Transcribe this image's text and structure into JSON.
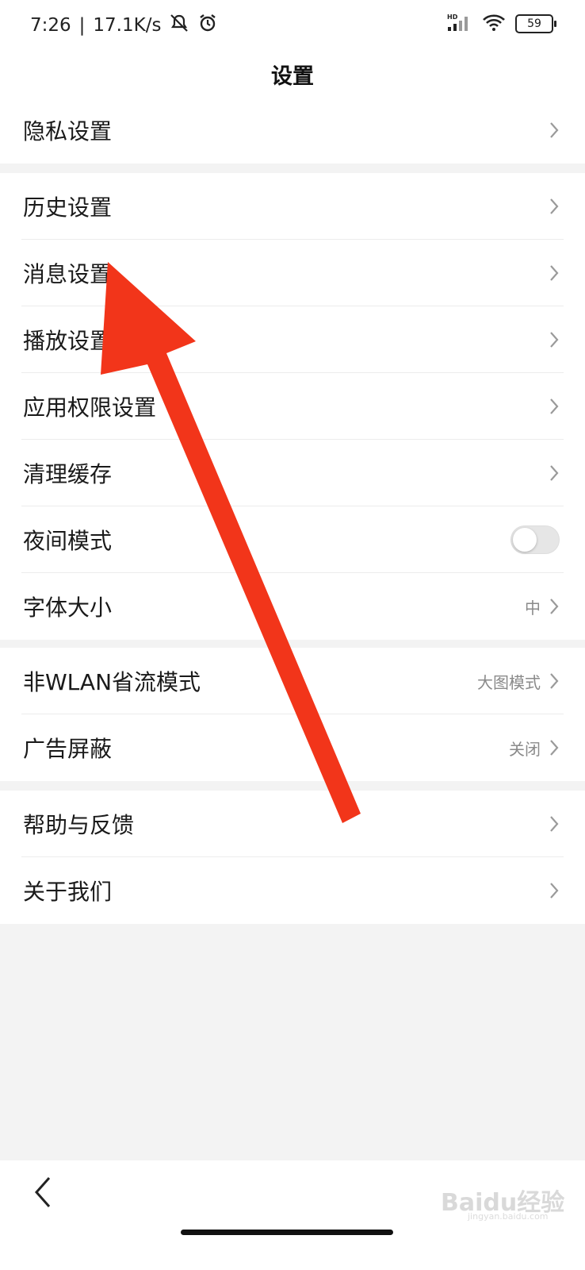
{
  "status_bar": {
    "time": "7:26",
    "network_speed": "17.1K/s",
    "signal_label": "HD",
    "battery": "59",
    "icons": [
      "mute-bell-icon",
      "alarm-icon",
      "signal-icon",
      "wifi-icon",
      "battery-icon"
    ]
  },
  "header": {
    "title": "设置"
  },
  "groups": {
    "privacy": {
      "items": [
        {
          "label": "隐私设置"
        }
      ]
    },
    "main": {
      "items": [
        {
          "label": "历史设置"
        },
        {
          "label": "消息设置"
        },
        {
          "label": "播放设置"
        },
        {
          "label": "应用权限设置"
        },
        {
          "label": "清理缓存"
        },
        {
          "label": "夜间模式",
          "toggle": false
        },
        {
          "label": "字体大小",
          "value": "中"
        }
      ]
    },
    "data": {
      "items": [
        {
          "label": "非WLAN省流模式",
          "value": "大图模式"
        },
        {
          "label": "广告屏蔽",
          "value": "关闭"
        }
      ]
    },
    "about": {
      "items": [
        {
          "label": "帮助与反馈"
        },
        {
          "label": "关于我们"
        }
      ]
    }
  },
  "watermark": {
    "text": "Baidu经验",
    "url": "jingyan.baidu.com"
  },
  "colors": {
    "annotation_arrow": "#f2351a",
    "page_bg": "#f3f3f3"
  }
}
